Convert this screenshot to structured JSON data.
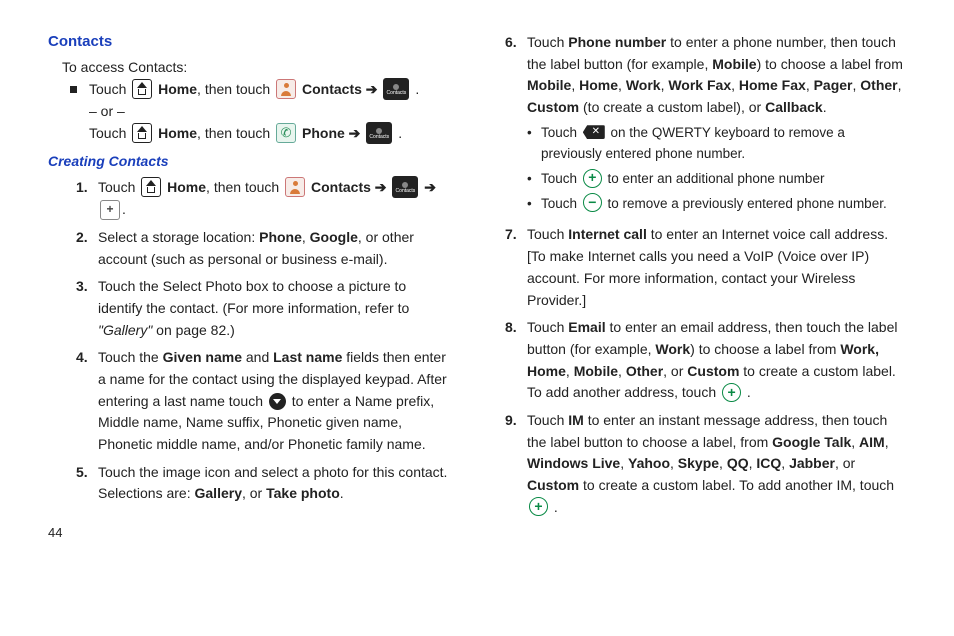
{
  "section_title": "Contacts",
  "intro": "To access Contacts:",
  "access": {
    "touch": "Touch",
    "home": "Home",
    "then_touch": ", then touch",
    "contacts": "Contacts",
    "phone": "Phone",
    "arrow": "➔",
    "or": "– or –",
    "period": "."
  },
  "sub_title": "Creating Contacts",
  "left_steps": {
    "s1a": "Touch ",
    "s1_home": "Home",
    "s1b": ", then touch ",
    "s1_contacts": "Contacts",
    "s1_arrow": " ➔ ",
    "s1_arrow2": " ➔",
    "s1_end": ".",
    "s2a": "Select a storage location: ",
    "s2b": "Phone",
    "s2c": ", ",
    "s2d": "Google",
    "s2e": ", or other account (such as personal or business e-mail).",
    "s3a": "Touch the Select Photo box to choose a picture to identify the contact. (For more information, refer to ",
    "s3b": "\"Gallery\"",
    "s3c": "  on page 82.)",
    "s4a": "Touch the ",
    "s4b": "Given name",
    "s4c": " and ",
    "s4d": "Last name",
    "s4e": " fields then enter a name for the contact using the displayed keypad. After entering a last name touch ",
    "s4f": " to enter a Name prefix, Middle name, Name suffix, Phonetic given name, Phonetic middle name, and/or Phonetic family name.",
    "s5a": "Touch the image icon and select a photo for this contact. Selections are: ",
    "s5b": "Gallery",
    "s5c": ", or ",
    "s5d": "Take photo",
    "s5e": "."
  },
  "right_steps": {
    "s6a": "Touch ",
    "s6b": "Phone number",
    "s6c": " to enter a phone number, then touch the label button (for example, ",
    "s6d": "Mobile",
    "s6e": ") to choose a label from ",
    "s6f": "Mobile",
    "s6g": ", ",
    "s6h": "Home",
    "s6i": ", ",
    "s6j": "Work",
    "s6k": ", ",
    "s6l": "Work Fax",
    "s6m": ", ",
    "s6n": "Home Fax",
    "s6o": ", ",
    "s6p": "Pager",
    "s6q": ", ",
    "s6r": "Other",
    "s6s": ", ",
    "s6t": "Custom",
    "s6u": " (to create a custom label), or ",
    "s6v": "Callback",
    "s6w": ".",
    "s6sub1a": "Touch ",
    "s6sub1b": " on the QWERTY keyboard to remove a previously entered phone number.",
    "s6sub2a": "Touch ",
    "s6sub2b": " to enter an additional phone number",
    "s6sub3a": "Touch ",
    "s6sub3b": " to remove a previously entered phone number.",
    "s7a": "Touch ",
    "s7b": "Internet call",
    "s7c": " to enter an Internet voice call address. [To make Internet calls you need a VoIP (Voice over IP) account. For more information, contact your Wireless Provider.]",
    "s8a": "Touch ",
    "s8b": "Email",
    "s8c": " to enter an email address, then touch the label button (for example, ",
    "s8d": "Work",
    "s8e": ") to choose a label from ",
    "s8f": "Work, Home",
    "s8g": ", ",
    "s8h": "Mobile",
    "s8i": ", ",
    "s8j": "Other",
    "s8k": ", or ",
    "s8l": "Custom",
    "s8m": " to create a custom label. To add another address, touch ",
    "s8n": " .",
    "s9a": "Touch ",
    "s9b": "IM",
    "s9c": " to enter an instant message address, then touch the label button to choose a label, from ",
    "s9d": "Google Talk",
    "s9e": ", ",
    "s9f": "AIM",
    "s9g": ", ",
    "s9h": "Windows Live",
    "s9i": ", ",
    "s9j": "Yahoo",
    "s9k": ", ",
    "s9l": "Skype",
    "s9m": ", ",
    "s9n": "QQ",
    "s9o": ", ",
    "s9p": "ICQ",
    "s9q": ", ",
    "s9r": "Jabber",
    "s9s": ", or ",
    "s9t": "Custom",
    "s9u": " to create a custom label. To add another IM, touch ",
    "s9v": " ."
  },
  "nums": {
    "n1": "1.",
    "n2": "2.",
    "n3": "3.",
    "n4": "4.",
    "n5": "5.",
    "n6": "6.",
    "n7": "7.",
    "n8": "8.",
    "n9": "9."
  },
  "page": "44"
}
